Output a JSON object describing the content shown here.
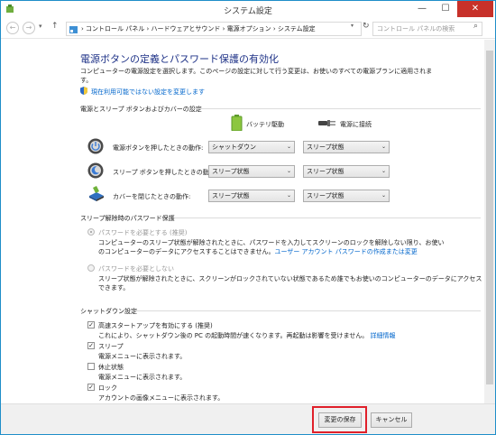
{
  "window": {
    "title": "システム設定",
    "minimize": "—",
    "maximize": "☐",
    "close": "✕"
  },
  "nav": {
    "back": "←",
    "forward": "→",
    "dropdown": "▾",
    "up": "↑",
    "breadcrumb": "› コントロール パネル › ハードウェアとサウンド › 電源オプション › システム設定",
    "refresh": "↻",
    "search_placeholder": "コントロール パネルの検索",
    "search_icon": "⌕"
  },
  "main": {
    "heading": "電源ボタンの定義とパスワード保護の有効化",
    "intro_line1": "コンピューターの電源設定を選択します。このページの設定に対して行う変更は、お使いのすべての電源プランに適用されま",
    "intro_line2": "す。",
    "change_unavailable_link": "現在利用可能ではない設定を変更します"
  },
  "power_section": {
    "title": "電源とスリープ ボタンおよびカバーの設定",
    "col_battery": "バッテリ駆動",
    "col_ac": "電源に接続",
    "rows": [
      {
        "label": "電源ボタンを押したときの動作:",
        "battery": "シャットダウン",
        "ac": "スリープ状態"
      },
      {
        "label": "スリープ ボタンを押したときの動作:",
        "battery": "スリープ状態",
        "ac": "スリープ状態"
      },
      {
        "label": "カバーを閉じたときの動作:",
        "battery": "スリープ状態",
        "ac": "スリープ状態"
      }
    ]
  },
  "password_section": {
    "title": "スリープ解除時のパスワード保護",
    "opt1_label": "パスワードを必要とする (推奨)",
    "opt1_desc1": "コンピューターのスリープ状態が解除されたときに、パスワードを入力してスクリーンのロックを解除しない限り、お使い",
    "opt1_desc2_prefix": "のコンピューターのデータにアクセスすることはできません。",
    "opt1_link": "ユーザー アカウント パスワードの作成または変更",
    "opt2_label": "パスワードを必要としない",
    "opt2_desc1": "スリープ状態が解除されたときに、スクリーンがロックされていない状態であるため誰でもお使いのコンピューターのデータにアクセス",
    "opt2_desc2": "できます。"
  },
  "shutdown_section": {
    "title": "シャットダウン設定",
    "items": [
      {
        "label": "高速スタートアップを有効にする (推奨)",
        "desc": "これにより、シャットダウン後の PC の起動時間が速くなります。再起動は影響を受けません。",
        "link": "詳細情報",
        "checked": true
      },
      {
        "label": "スリープ",
        "desc": "電源メニューに表示されます。",
        "checked": true
      },
      {
        "label": "休止状態",
        "desc": "電源メニューに表示されます。",
        "checked": false
      },
      {
        "label": "ロック",
        "desc": "アカウントの画像メニューに表示されます。",
        "checked": true
      }
    ]
  },
  "buttons": {
    "save": "変更の保存",
    "cancel": "キャンセル"
  },
  "glyphs": {
    "check": "✓",
    "select_arrow": "⌄"
  },
  "colors": {
    "heading": "#1e3287",
    "link": "#0066cc",
    "highlight_box": "#e0202a",
    "close_button": "#c7312a"
  }
}
